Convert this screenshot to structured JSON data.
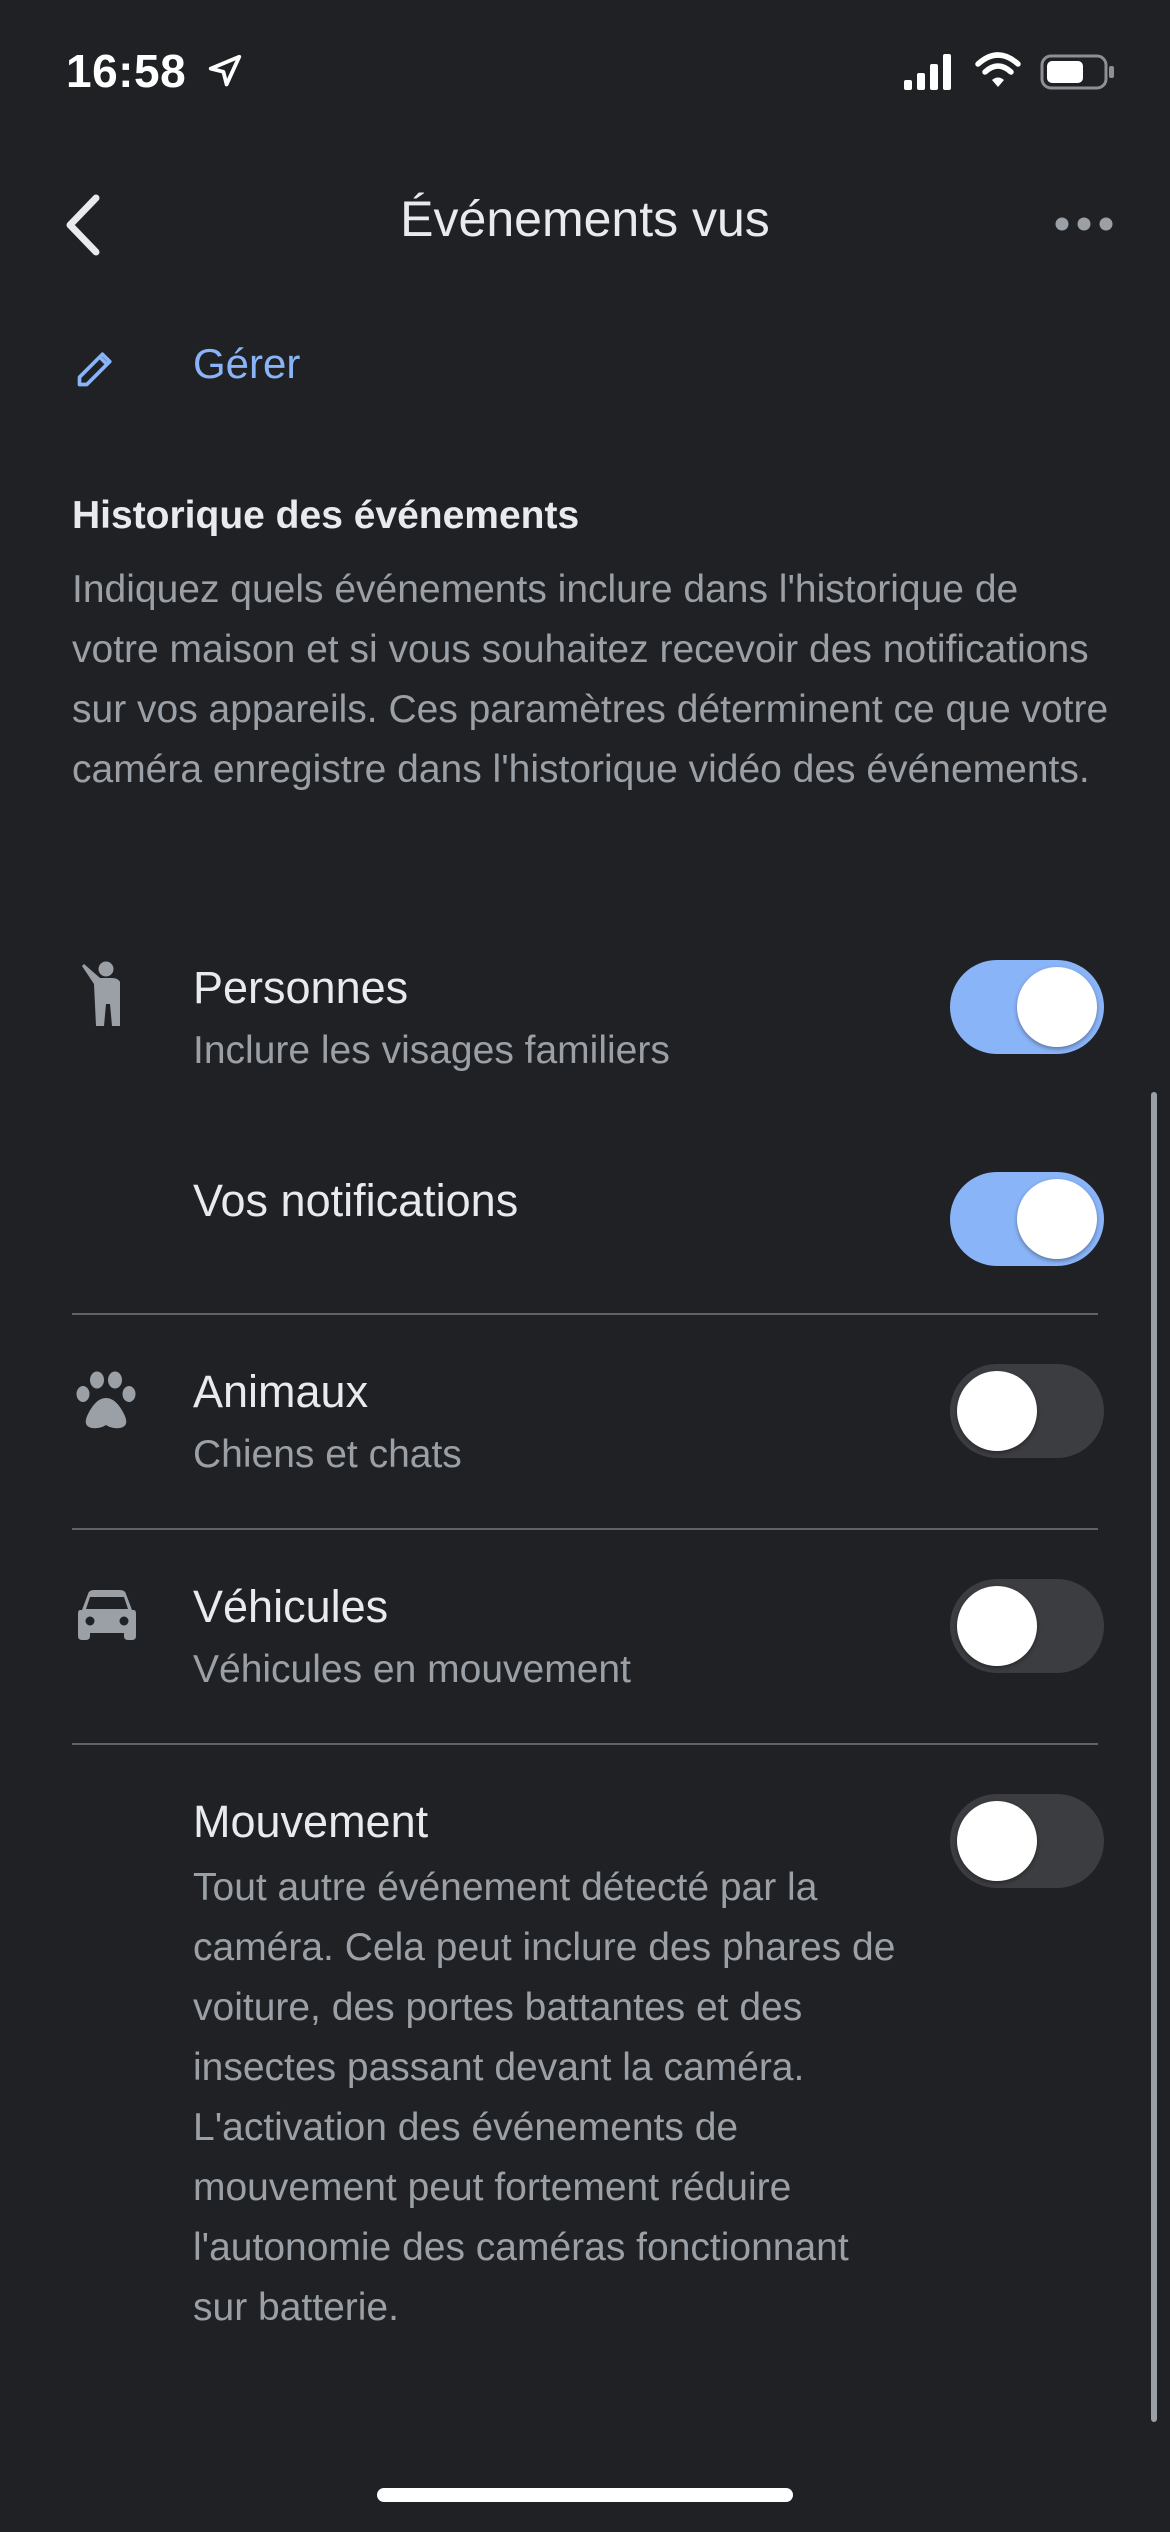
{
  "status_bar": {
    "time": "16:58",
    "icons": [
      "location-arrow-icon",
      "cellular-signal-icon",
      "wifi-icon",
      "battery-icon"
    ]
  },
  "header": {
    "title": "Événements vus",
    "back_icon": "chevron-left-icon",
    "more_icon": "more-horizontal-icon"
  },
  "manage": {
    "label": "Gérer",
    "icon": "pencil-icon"
  },
  "section": {
    "title": "Historique des événements",
    "description": "Indiquez quels événements inclure dans l'historique de votre maison et si vous souhaitez recevoir des notifications sur vos appareils. Ces paramètres déterminent ce que votre caméra enregistre dans l'historique vidéo des événements."
  },
  "settings": {
    "people": {
      "label": "Personnes",
      "sublabel": "Inclure les visages familiers",
      "icon": "person-waving-icon",
      "enabled": true
    },
    "notifications": {
      "label": "Vos notifications",
      "enabled": true
    },
    "animals": {
      "label": "Animaux",
      "sublabel": "Chiens et chats",
      "icon": "paw-icon",
      "enabled": false
    },
    "vehicles": {
      "label": "Véhicules",
      "sublabel": "Véhicules en mouvement",
      "icon": "car-icon",
      "enabled": false
    },
    "motion": {
      "label": "Mouvement",
      "description": "Tout autre événement détecté par la caméra. Cela peut inclure des phares de voiture, des portes battantes et des insectes passant devant la caméra. L'activation des événements de mouvement peut fortement réduire l'autonomie des caméras fonctionnant sur batterie.",
      "enabled": false
    }
  },
  "colors": {
    "background": "#202124",
    "accent": "#8ab4f8",
    "text_primary": "#e8eaed",
    "text_secondary": "#9aa0a6",
    "toggle_off": "#3c3d41",
    "divider": "#5f6368"
  }
}
